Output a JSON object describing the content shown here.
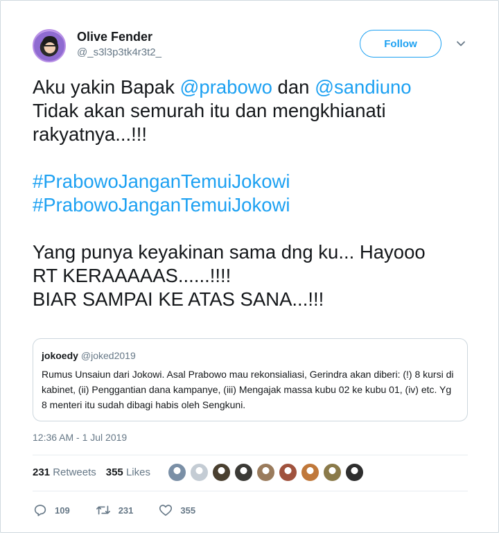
{
  "user": {
    "name": "Olive Fender",
    "handle": "@_s3l3p3tk4r3t2_",
    "follow_label": "Follow"
  },
  "tweet": {
    "line1_a": "Aku yakin Bapak ",
    "mention1": "@prabowo",
    "line1_b": " dan ",
    "mention2": "@sandiuno",
    "line2": "Tidak akan semurah itu dan mengkhianati",
    "line3": "rakyatnya...!!!",
    "hashtag1": "#PrabowoJanganTemuiJokowi",
    "hashtag2": "#PrabowoJanganTemuiJokowi",
    "line4": "Yang punya keyakinan sama dng ku... Hayooo",
    "line5": "RT KERAAAAAS......!!!!",
    "line6": "BIAR SAMPAI KE ATAS SANA...!!!"
  },
  "quote": {
    "name": "jokoedy",
    "handle": "@joked2019",
    "text": "Rumus Unsaiun dari Jokowi. Asal Prabowo mau rekonsialiasi, Gerindra akan diberi: (!) 8 kursi di kabinet, (ii) Penggantian dana kampanye, (iii) Mengajak massa kubu 02 ke kubu 01, (iv) etc. Yg 8 menteri itu sudah dibagi habis oleh Sengkuni."
  },
  "timestamp": "12:36 AM - 1 Jul 2019",
  "stats": {
    "retweets_count": "231",
    "retweets_label": "Retweets",
    "likes_count": "355",
    "likes_label": "Likes"
  },
  "likers": {
    "colors": [
      "#7a8fa6",
      "#c4ccd4",
      "#4a4030",
      "#3b3a36",
      "#9a7b5c",
      "#a0523d",
      "#c0783a",
      "#8a7a4a",
      "#2e2e2e"
    ]
  },
  "actions": {
    "reply_count": "109",
    "retweet_count": "231",
    "like_count": "355"
  },
  "colors": {
    "accent": "#1da1f2",
    "text": "#14171a",
    "muted": "#657786"
  }
}
